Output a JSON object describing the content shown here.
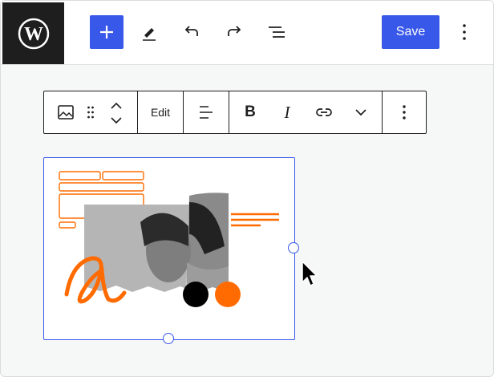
{
  "topbar": {
    "logo": "wordpress-logo",
    "icons": [
      "plus-icon",
      "pencil-icon",
      "undo-icon",
      "redo-icon",
      "list-view-icon"
    ],
    "save_label": "Save",
    "options_icon": "vertical-dots-icon"
  },
  "block_toolbar": {
    "items": [
      "image-icon",
      "drag-handle-icon",
      "move-up-icon",
      "move-down-icon"
    ],
    "edit_label": "Edit",
    "formatting": [
      "align-icon",
      "bold-icon",
      "italic-icon",
      "link-icon",
      "chevron-down-icon"
    ],
    "more_icon": "vertical-dots-icon",
    "bold_glyph": "B",
    "italic_glyph": "I"
  },
  "image_block": {
    "selected": true,
    "accent_color": "#3858e9",
    "illustration_colors": {
      "orange": "#ff6b00",
      "black": "#000000",
      "photo_gray": "#b8b8b8"
    }
  }
}
